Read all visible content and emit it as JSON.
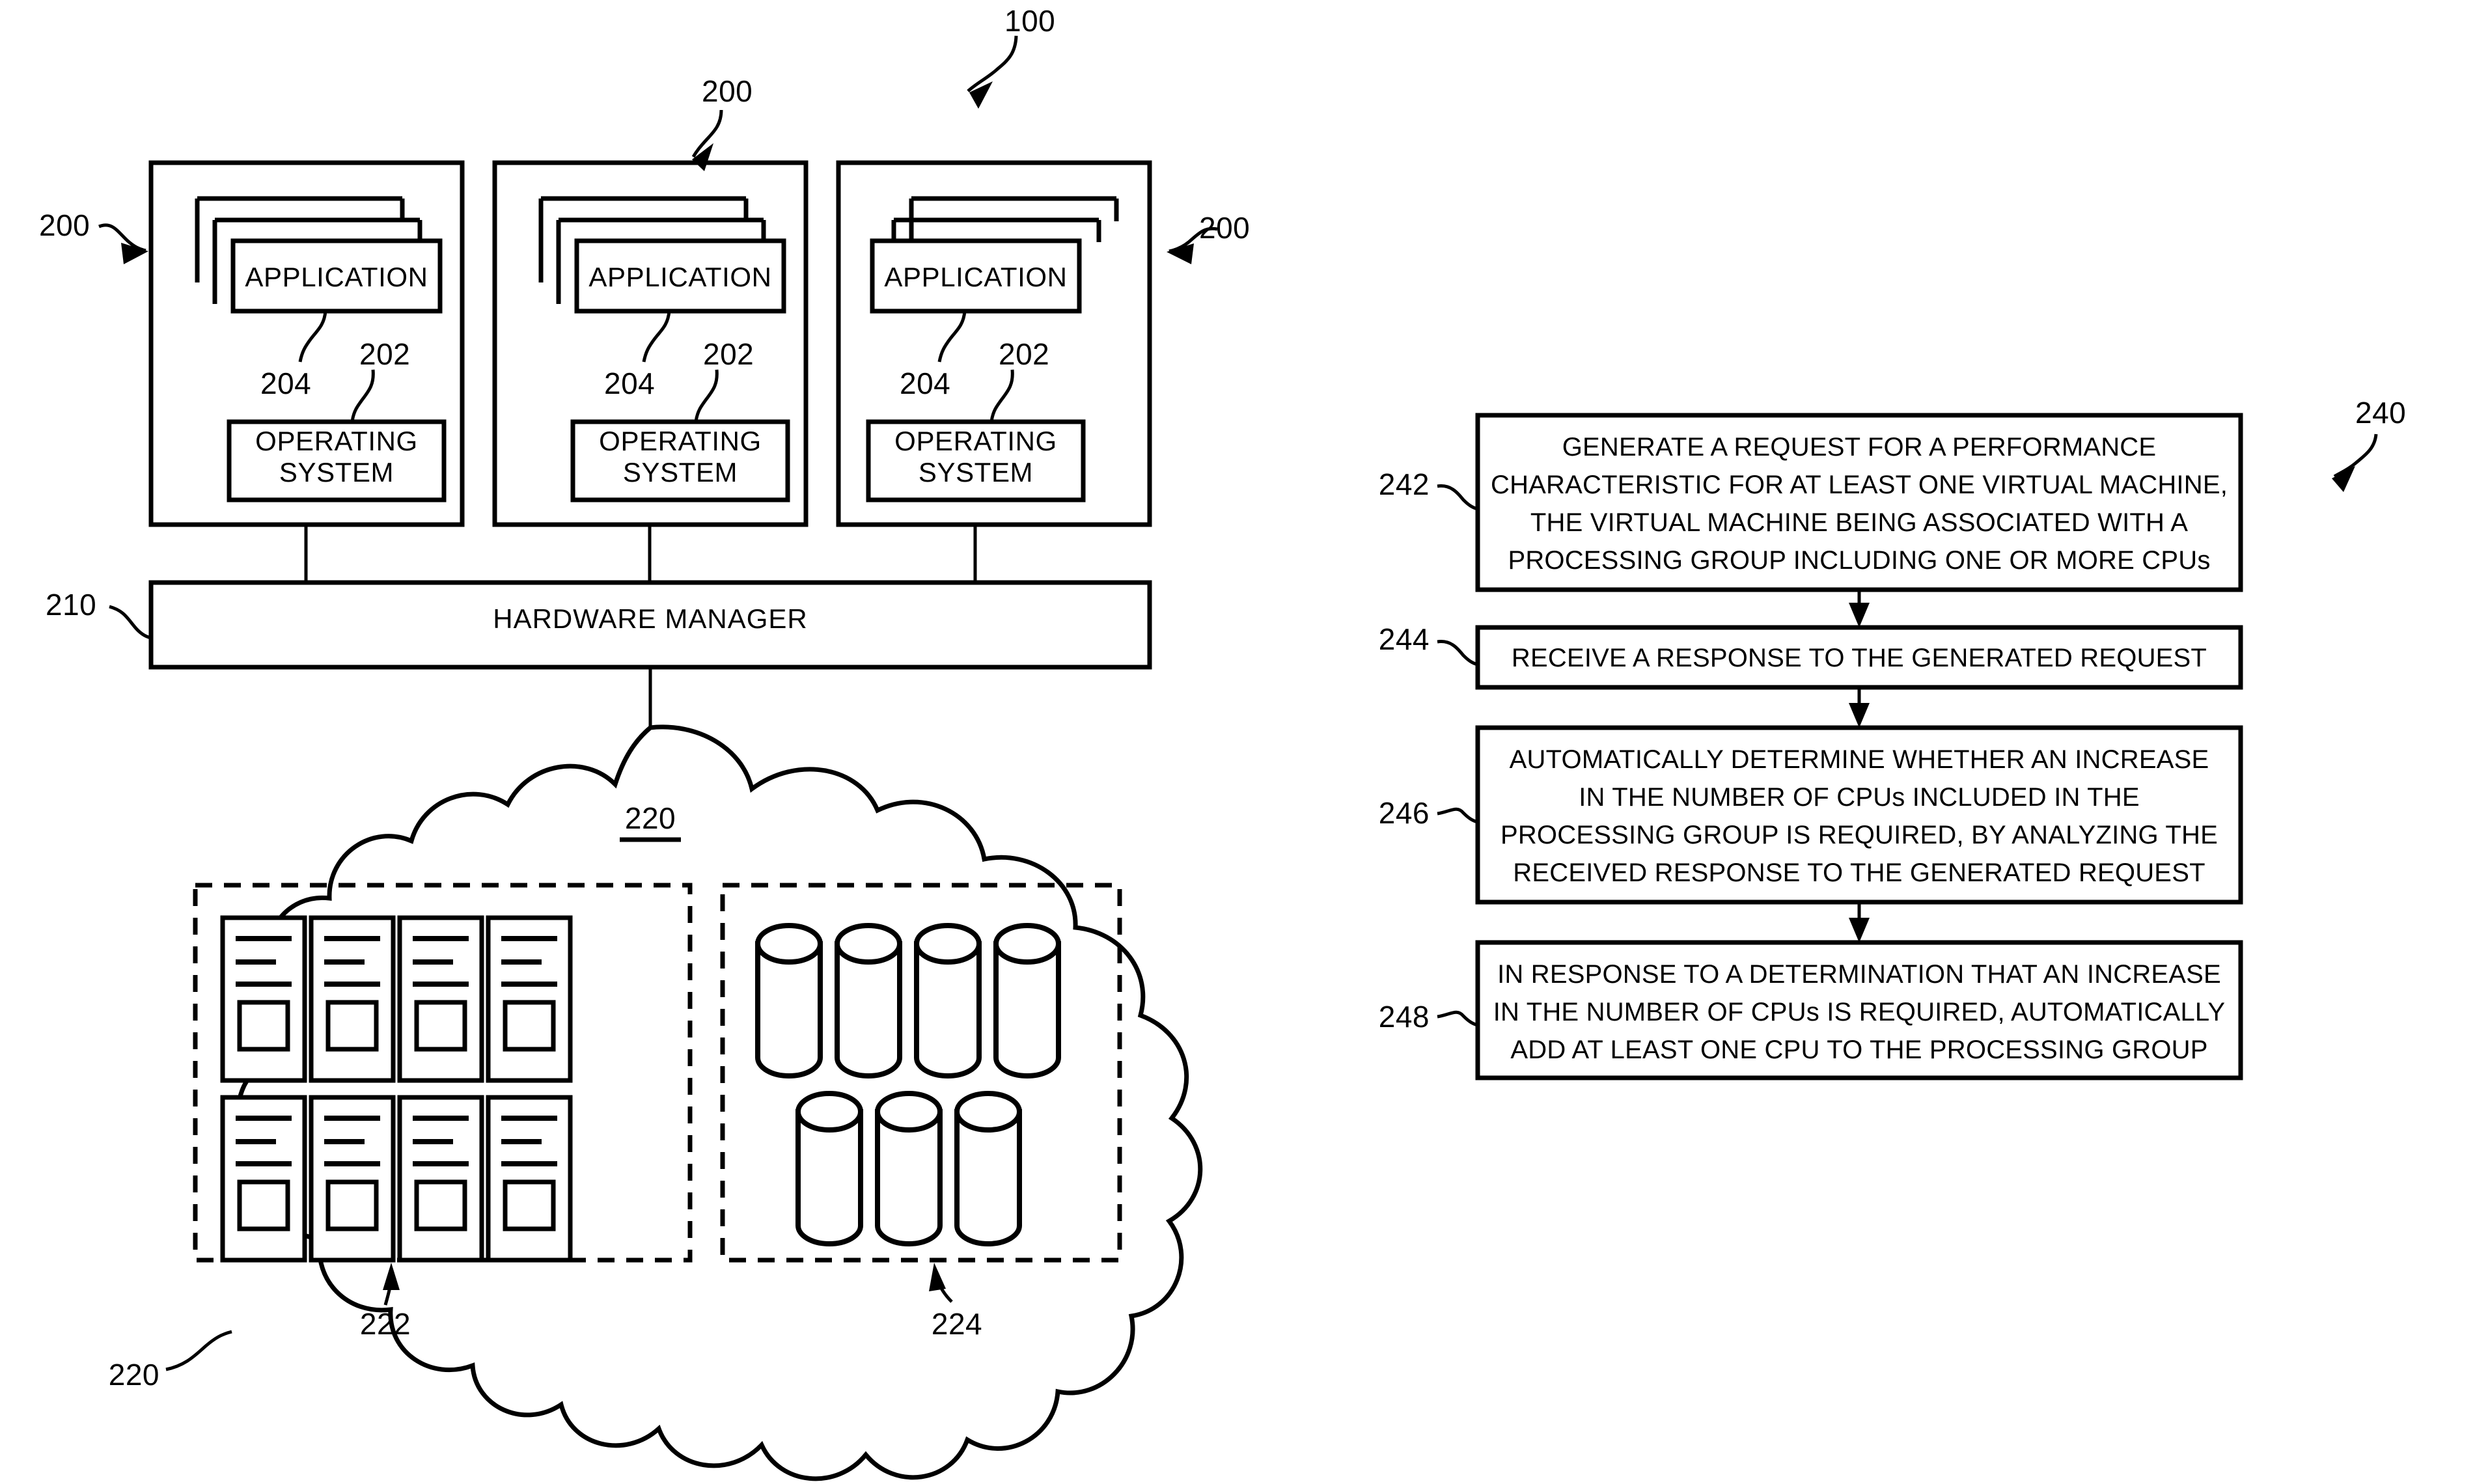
{
  "figure": {
    "overall_ref": "100",
    "system_diagram": {
      "vm_refs": [
        "200",
        "200",
        "200"
      ],
      "vms": [
        {
          "application_label": "APPLICATION",
          "os_label_line1": "OPERATING",
          "os_label_line2": "SYSTEM",
          "app_ref": "204",
          "os_ref": "202"
        },
        {
          "application_label": "APPLICATION",
          "os_label_line1": "OPERATING",
          "os_label_line2": "SYSTEM",
          "app_ref": "204",
          "os_ref": "202"
        },
        {
          "application_label": "APPLICATION",
          "os_label_line1": "OPERATING",
          "os_label_line2": "SYSTEM",
          "app_ref": "204",
          "os_ref": "202"
        }
      ],
      "hardware_manager": {
        "label": "HARDWARE MANAGER",
        "ref": "210"
      },
      "cloud": {
        "ref_inner": "220",
        "ref_outer": "220",
        "server_group": {
          "ref": "222",
          "count": 8,
          "rows": 2,
          "cols": 4
        },
        "storage_group": {
          "ref": "224",
          "count": 7,
          "row1": 4,
          "row2": 3
        }
      }
    },
    "flowchart": {
      "ref": "240",
      "steps": [
        {
          "ref": "242",
          "lines": [
            "GENERATE A REQUEST FOR A PERFORMANCE",
            "CHARACTERISTIC FOR AT LEAST ONE VIRTUAL MACHINE,",
            "THE VIRTUAL MACHINE BEING ASSOCIATED WITH A",
            "PROCESSING GROUP INCLUDING ONE OR MORE CPUs"
          ]
        },
        {
          "ref": "244",
          "lines": [
            "RECEIVE A RESPONSE TO THE GENERATED REQUEST"
          ]
        },
        {
          "ref": "246",
          "lines": [
            "AUTOMATICALLY DETERMINE WHETHER AN INCREASE",
            "IN THE NUMBER OF CPUs INCLUDED IN THE",
            "PROCESSING GROUP IS REQUIRED, BY ANALYZING THE",
            "RECEIVED RESPONSE TO THE GENERATED REQUEST"
          ]
        },
        {
          "ref": "248",
          "lines": [
            "IN RESPONSE TO A DETERMINATION THAT AN INCREASE",
            "IN THE NUMBER OF CPUs IS REQUIRED, AUTOMATICALLY",
            "ADD AT LEAST ONE CPU TO THE PROCESSING GROUP"
          ]
        }
      ]
    },
    "colors": {
      "ink": "#000000",
      "paper": "#ffffff"
    }
  }
}
